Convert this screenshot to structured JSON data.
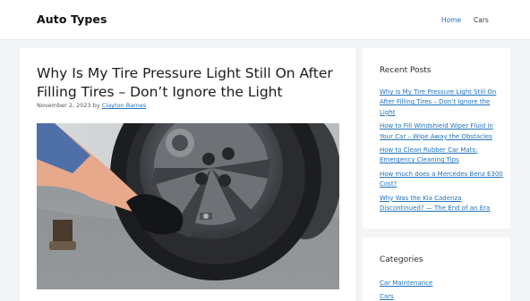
{
  "site": {
    "title": "Auto Types"
  },
  "nav": {
    "items": [
      {
        "label": "Home",
        "active": true
      },
      {
        "label": "Cars",
        "active": false
      }
    ]
  },
  "post": {
    "title": "Why Is My Tire Pressure Light Still On After Filling Tires – Don’t Ignore the Light",
    "date": "November 2, 2023",
    "by": "by",
    "author": "Clayton Barnes"
  },
  "sidebar": {
    "recent": {
      "title": "Recent Posts",
      "items": [
        "Why Is My Tire Pressure Light Still On After Filling Tires – Don’t Ignore the Light",
        "How to Fill Windshield Wiper Fluid in Your Car – Wipe Away the Obstacles",
        "How to Clean Rubber Car Mats: Emergency Cleaning Tips",
        "How much does a Mercedes Benz E300 Cost?",
        "Why Was the Kia Cadenza Discontinued? — The End of an Era"
      ]
    },
    "categories": {
      "title": "Categories",
      "items": [
        "Car Maintenance",
        "Cars"
      ]
    }
  },
  "colors": {
    "link": "#1e72bd",
    "background": "#f2f4f6",
    "card": "#ffffff"
  }
}
